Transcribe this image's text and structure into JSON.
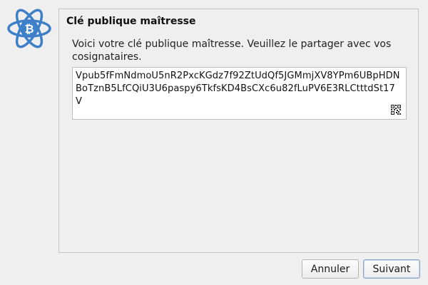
{
  "page": {
    "title": "Clé publique maîtresse",
    "description": "Voici votre clé publique maîtresse. Veuillez le partager avec vos cosignataires."
  },
  "key": {
    "value": "Vpub5fFmNdmoU5nR2PxcKGdz7f92ZtUdQf5JGMmjXV8YPm6UBpHDNBoTznB5LfCQiU3U6paspy6TkfsKD4BsCXc6u82fLuPV6E3RLCtttdSt17V",
    "qr_icon": "qr-code-icon"
  },
  "buttons": {
    "cancel_label": "Annuler",
    "next_label": "Suivant"
  },
  "logo": {
    "icon": "electrum-logo-icon",
    "color": "#3d80c8"
  }
}
